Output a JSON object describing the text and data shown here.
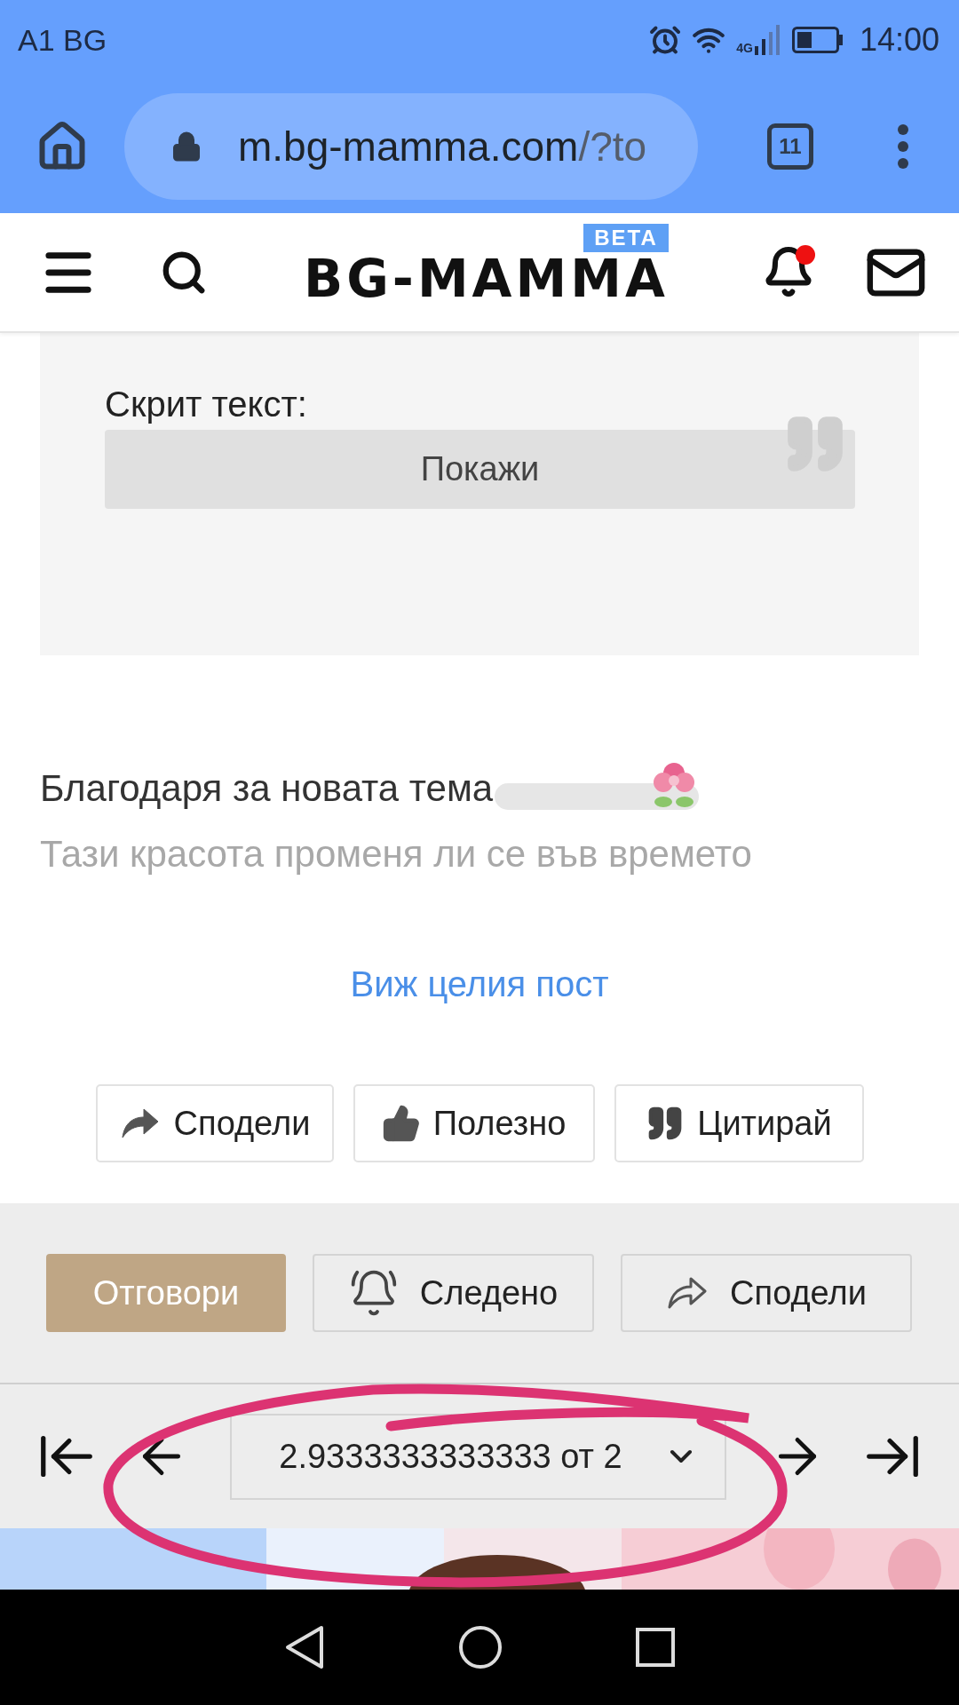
{
  "status_bar": {
    "carrier": "A1 BG",
    "network": "4G",
    "time": "14:00"
  },
  "browser": {
    "url_host": "m.bg-mamma.com",
    "url_path": "/?to",
    "tab_count": "11"
  },
  "site_header": {
    "logo": "BG-MAMMA",
    "badge": "BETA",
    "has_notification": true
  },
  "hidden_text": {
    "label": "Скрит текст:",
    "button": "Покажи"
  },
  "post": {
    "lines": [
      "Благодаря за новата тема",
      "Тази красота променя ли се във времето"
    ],
    "more_link": "Виж целия пост"
  },
  "post_actions": [
    {
      "kind": "share",
      "label": "Сподели"
    },
    {
      "kind": "like",
      "label": "Полезно"
    },
    {
      "kind": "quote",
      "label": "Цитирай"
    }
  ],
  "topic_actions": [
    {
      "kind": "reply",
      "label": "Отговори"
    },
    {
      "kind": "follow",
      "label": "Следено"
    },
    {
      "kind": "share",
      "label": "Сподели"
    }
  ],
  "pager": {
    "page_select": "2.9333333333333 от 2"
  }
}
